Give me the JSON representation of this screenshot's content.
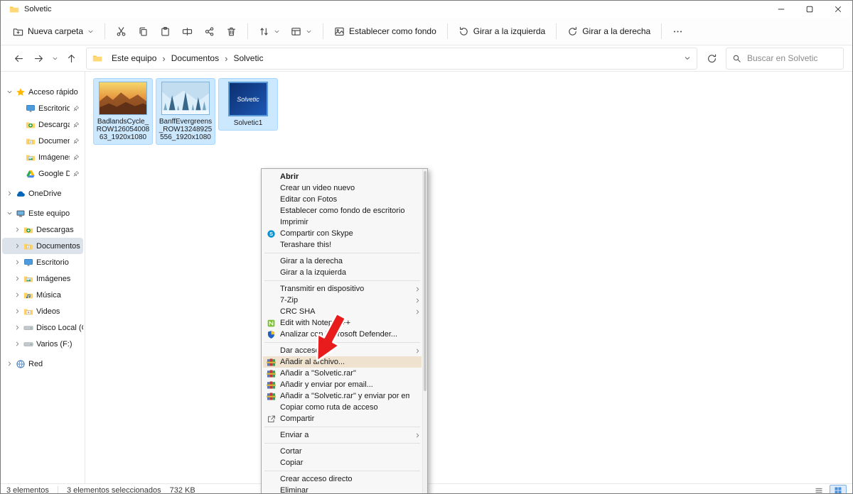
{
  "titlebar": {
    "title": "Solvetic"
  },
  "toolbar": {
    "new_folder_label": "Nueva carpeta",
    "icon_buttons": [
      {
        "name": "cut",
        "icon": "cut"
      },
      {
        "name": "copy",
        "icon": "copy"
      },
      {
        "name": "paste",
        "icon": "paste"
      },
      {
        "name": "rename",
        "icon": "rename"
      },
      {
        "name": "share",
        "icon": "share"
      },
      {
        "name": "delete",
        "icon": "trash"
      }
    ],
    "actions": [
      {
        "label": "Establecer como fondo",
        "icon": "wallpaper"
      },
      {
        "label": "Girar a la izquierda",
        "icon": "rotate-left"
      },
      {
        "label": "Girar a la derecha",
        "icon": "rotate-right"
      }
    ]
  },
  "addressbar": {
    "breadcrumbs": [
      "Este equipo",
      "Documentos",
      "Solvetic"
    ],
    "search_placeholder": "Buscar en Solvetic"
  },
  "sidebar": {
    "sections": [
      {
        "label": "Acceso rápido",
        "icon": "star",
        "expander": "down",
        "children": [
          {
            "label": "Escritorio",
            "icon": "desktop",
            "pin": true
          },
          {
            "label": "Descargas",
            "icon": "downloads",
            "pin": true
          },
          {
            "label": "Documentos",
            "icon": "documents",
            "pin": true
          },
          {
            "label": "Imágenes",
            "icon": "pictures",
            "pin": true
          },
          {
            "label": "Google Drive",
            "icon": "gdrive",
            "pin": true
          }
        ]
      },
      {
        "label": "OneDrive",
        "icon": "cloud",
        "expander": "right",
        "children": []
      },
      {
        "label": "Este equipo",
        "icon": "pc",
        "expander": "down",
        "children": [
          {
            "label": "Descargas",
            "icon": "downloads",
            "expander": "right"
          },
          {
            "label": "Documentos",
            "icon": "documents",
            "expander": "right",
            "selected": true
          },
          {
            "label": "Escritorio",
            "icon": "desktop",
            "expander": "right"
          },
          {
            "label": "Imágenes",
            "icon": "pictures",
            "expander": "right"
          },
          {
            "label": "Música",
            "icon": "music",
            "expander": "right"
          },
          {
            "label": "Videos",
            "icon": "videos",
            "expander": "right"
          },
          {
            "label": "Disco Local (C:)",
            "icon": "drive",
            "expander": "right"
          },
          {
            "label": "Varios (F:)",
            "icon": "drive",
            "expander": "right"
          }
        ]
      },
      {
        "label": "Red",
        "icon": "network",
        "expander": "right",
        "children": []
      }
    ]
  },
  "files": [
    {
      "label": "BadlandsCycle_ROW12605400863_1920x1080",
      "thumb": "badlands",
      "selected": true
    },
    {
      "label": "BanffEvergreens_ROW13248925556_1920x1080",
      "thumb": "banff",
      "selected": true
    },
    {
      "label": "Solvetic1",
      "thumb": "solvetic",
      "thumb_text": "Solvetic",
      "selected": true
    }
  ],
  "context_menu": {
    "groups": [
      {
        "items": [
          {
            "label": "Abrir",
            "bold": true
          },
          {
            "label": "Crear un video nuevo"
          },
          {
            "label": "Editar con Fotos"
          },
          {
            "label": "Establecer como fondo de escritorio"
          },
          {
            "label": "Imprimir"
          },
          {
            "label": "Compartir con Skype",
            "icon": "skype"
          },
          {
            "label": "Terashare this!"
          }
        ]
      },
      {
        "items": [
          {
            "label": "Girar a la derecha"
          },
          {
            "label": "Girar a la izquierda"
          }
        ]
      },
      {
        "items": [
          {
            "label": "Transmitir en dispositivo",
            "submenu": true
          },
          {
            "label": "7-Zip",
            "submenu": true
          },
          {
            "label": "CRC SHA",
            "submenu": true
          },
          {
            "label": "Edit with Notepad++",
            "icon": "npp"
          },
          {
            "label": "Analizar con Microsoft Defender...",
            "icon": "defender"
          }
        ]
      },
      {
        "items": [
          {
            "label": "Dar acceso a",
            "submenu": true
          },
          {
            "label": "Añadir al archivo...",
            "icon": "winrar",
            "highlighted": true
          },
          {
            "label": "Añadir a \"Solvetic.rar\"",
            "icon": "winrar"
          },
          {
            "label": "Añadir y enviar por email...",
            "icon": "winrar"
          },
          {
            "label": "Añadir a \"Solvetic.rar\" y enviar por email",
            "icon": "winrar"
          },
          {
            "label": "Copiar como ruta de acceso"
          },
          {
            "label": "Compartir",
            "icon": "share-menu"
          }
        ]
      },
      {
        "items": [
          {
            "label": "Enviar a",
            "submenu": true
          }
        ]
      },
      {
        "items": [
          {
            "label": "Cortar"
          },
          {
            "label": "Copiar"
          }
        ]
      },
      {
        "items": [
          {
            "label": "Crear acceso directo"
          },
          {
            "label": "Eliminar"
          }
        ]
      }
    ]
  },
  "statusbar": {
    "items_count": "3 elementos",
    "selected_count": "3 elementos seleccionados",
    "selected_size": "732 KB"
  },
  "colors": {
    "accent": "#0067c0",
    "selection_bg": "#cce8ff",
    "menu_highlight": "#efe3cf",
    "arrow_red": "#e81c1c"
  }
}
